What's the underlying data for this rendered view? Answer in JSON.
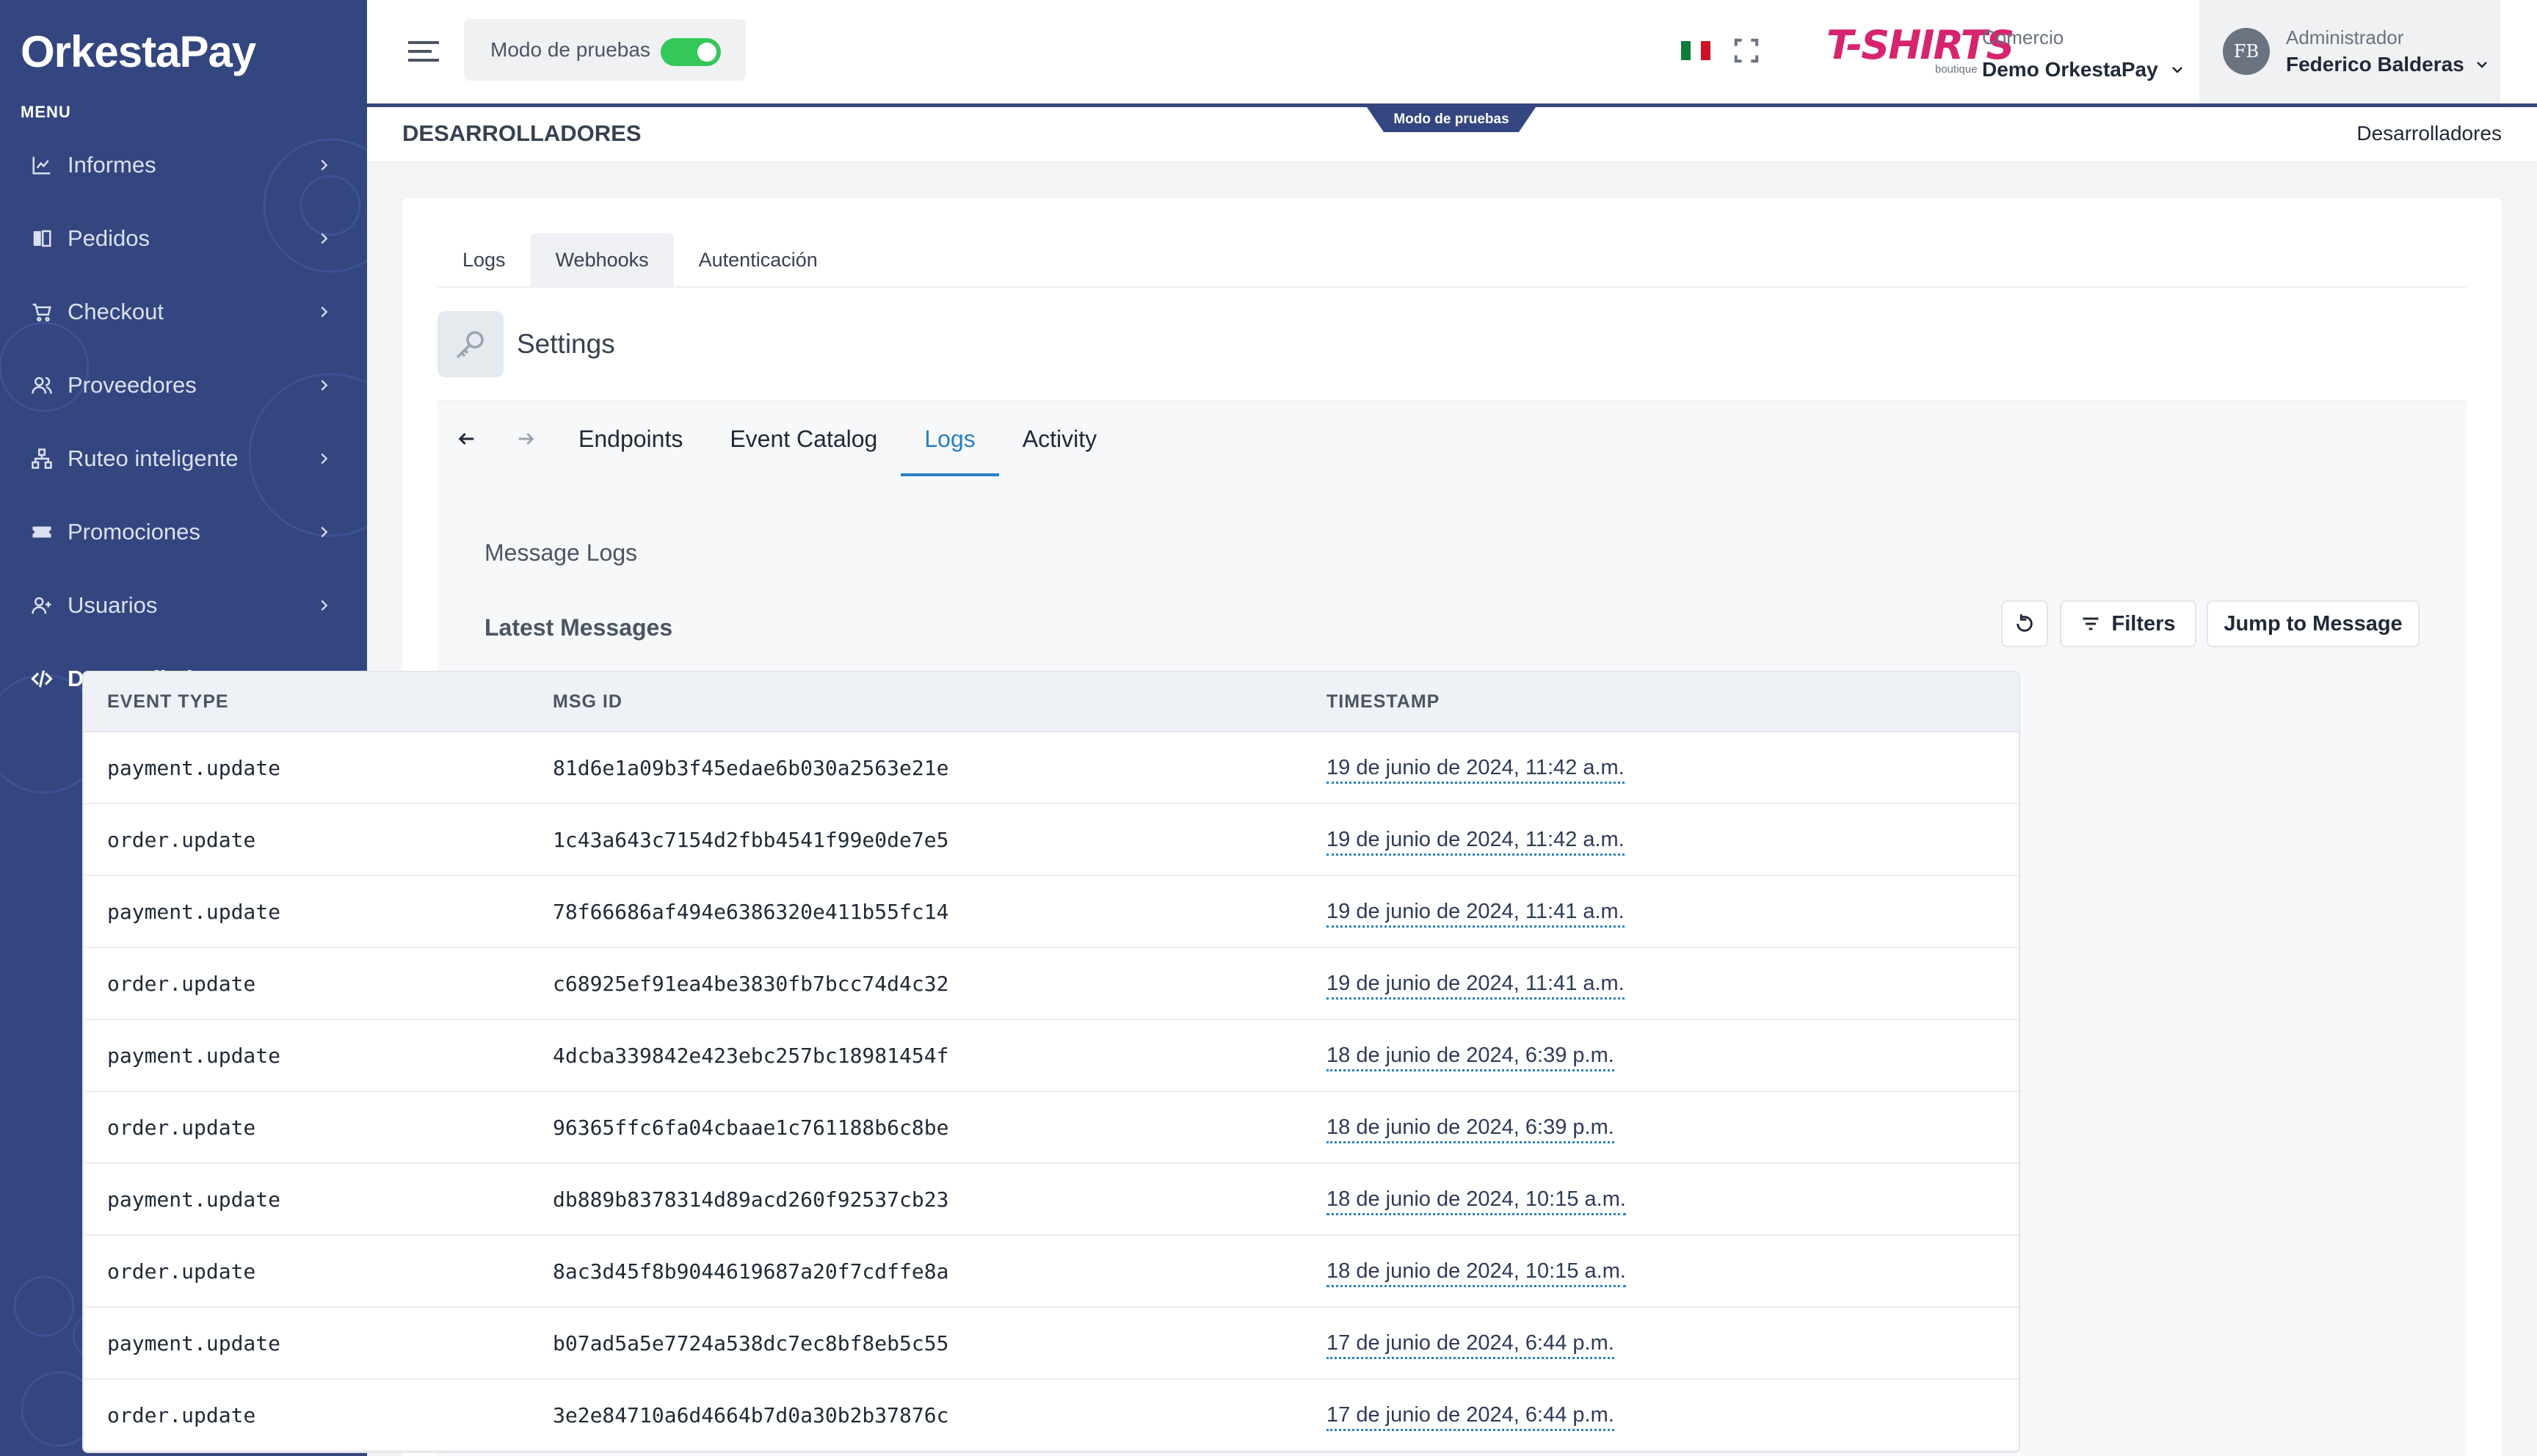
{
  "app": {
    "logo": "OrkestaPay",
    "menu_label": "MENU"
  },
  "sidebar": {
    "items": [
      {
        "label": "Informes",
        "icon": "chart-line-icon"
      },
      {
        "label": "Pedidos",
        "icon": "book-icon"
      },
      {
        "label": "Checkout",
        "icon": "cart-icon"
      },
      {
        "label": "Proveedores",
        "icon": "users-icon"
      },
      {
        "label": "Ruteo inteligente",
        "icon": "sitemap-icon"
      },
      {
        "label": "Promociones",
        "icon": "ticket-icon"
      },
      {
        "label": "Usuarios",
        "icon": "user-plus-icon"
      },
      {
        "label": "Desarrolladores",
        "icon": "code-icon",
        "active": true
      }
    ]
  },
  "header": {
    "mode_label": "Modo de pruebas",
    "mode_enabled": true,
    "brand_logo": "T-SHIRTS",
    "brand_sub": "boutique",
    "store_label": "Comercio",
    "store_name": "Demo OrkestaPay",
    "user_initials": "FB",
    "user_role": "Administrador",
    "user_name": "Federico Balderas",
    "accent": "#34467f",
    "toggle_color": "#34c759"
  },
  "page": {
    "title": "DESARROLLADORES",
    "breadcrumb": "Desarrolladores",
    "ribbon": "Modo de pruebas"
  },
  "tabs": [
    {
      "label": "Logs"
    },
    {
      "label": "Webhooks",
      "active": true
    },
    {
      "label": "Autenticación"
    }
  ],
  "settings": {
    "title": "Settings"
  },
  "portal": {
    "tabs": [
      {
        "label": "Endpoints"
      },
      {
        "label": "Event Catalog"
      },
      {
        "label": "Logs",
        "active": true
      },
      {
        "label": "Activity"
      }
    ],
    "section_title": "Message Logs",
    "latest_title": "Latest Messages",
    "filters_label": "Filters",
    "jump_label": "Jump to Message",
    "columns": [
      "EVENT TYPE",
      "MSG ID",
      "TIMESTAMP"
    ],
    "rows": [
      {
        "event": "payment.update",
        "id": "81d6e1a09b3f45edae6b030a2563e21e",
        "ts": "19 de junio de 2024, 11:42 a.m."
      },
      {
        "event": "order.update",
        "id": "1c43a643c7154d2fbb4541f99e0de7e5",
        "ts": "19 de junio de 2024, 11:42 a.m."
      },
      {
        "event": "payment.update",
        "id": "78f66686af494e6386320e411b55fc14",
        "ts": "19 de junio de 2024, 11:41 a.m."
      },
      {
        "event": "order.update",
        "id": "c68925ef91ea4be3830fb7bcc74d4c32",
        "ts": "19 de junio de 2024, 11:41 a.m."
      },
      {
        "event": "payment.update",
        "id": "4dcba339842e423ebc257bc18981454f",
        "ts": "18 de junio de 2024, 6:39 p.m."
      },
      {
        "event": "order.update",
        "id": "96365ffc6fa04cbaae1c761188b6c8be",
        "ts": "18 de junio de 2024, 6:39 p.m."
      },
      {
        "event": "payment.update",
        "id": "db889b8378314d89acd260f92537cb23",
        "ts": "18 de junio de 2024, 10:15 a.m."
      },
      {
        "event": "order.update",
        "id": "8ac3d45f8b9044619687a20f7cdffe8a",
        "ts": "18 de junio de 2024, 10:15 a.m."
      },
      {
        "event": "payment.update",
        "id": "b07ad5a5e7724a538dc7ec8bf8eb5c55",
        "ts": "17 de junio de 2024, 6:44 p.m."
      },
      {
        "event": "order.update",
        "id": "3e2e84710a6d4664b7d0a30b2b37876c",
        "ts": "17 de junio de 2024, 6:44 p.m."
      }
    ]
  }
}
